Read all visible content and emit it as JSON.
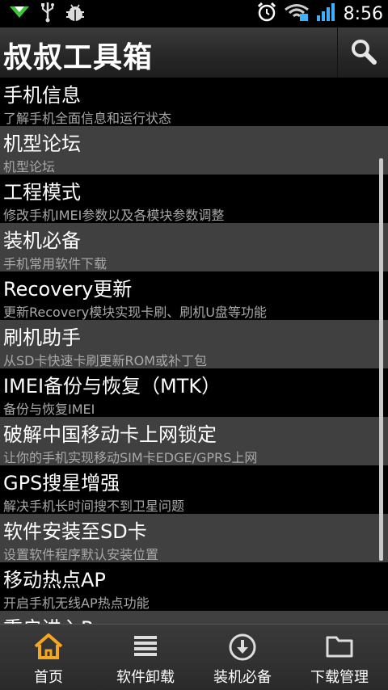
{
  "status": {
    "time": "8:56"
  },
  "app": {
    "title": "叔叔工具箱"
  },
  "list": [
    {
      "title": "手机信息",
      "subtitle": "了解手机全面信息和运行状态"
    },
    {
      "title": "机型论坛",
      "subtitle": "机型论坛"
    },
    {
      "title": "工程模式",
      "subtitle": "修改手机IMEI参数以及各模块参数调整"
    },
    {
      "title": "装机必备",
      "subtitle": "手机常用软件下载"
    },
    {
      "title": "Recovery更新",
      "subtitle": "更新Recovery模块实现卡刷、刷机U盘等功能"
    },
    {
      "title": "刷机助手",
      "subtitle": "从SD卡快速卡刷更新ROM或补丁包"
    },
    {
      "title": "IMEI备份与恢复（MTK）",
      "subtitle": "备份与恢复IMEI"
    },
    {
      "title": "破解中国移动卡上网锁定",
      "subtitle": "让你的手机实现移动SIM卡EDGE/GPRS上网"
    },
    {
      "title": "GPS搜星增强",
      "subtitle": "解决手机长时间搜不到卫星问题"
    },
    {
      "title": "软件安装至SD卡",
      "subtitle": "设置软件程序默认安装位置"
    },
    {
      "title": "移动热点AP",
      "subtitle": "开启手机无线AP热点功能"
    },
    {
      "title": "重启进入Recovery",
      "subtitle": ""
    }
  ],
  "nav": [
    {
      "label": "首页",
      "icon": "home-icon",
      "color": "#f5a623"
    },
    {
      "label": "软件卸载",
      "icon": "list-icon",
      "color": "#ffffff"
    },
    {
      "label": "装机必备",
      "icon": "download-icon",
      "color": "#ffffff"
    },
    {
      "label": "下载管理",
      "icon": "folder-icon",
      "color": "#ffffff"
    }
  ]
}
